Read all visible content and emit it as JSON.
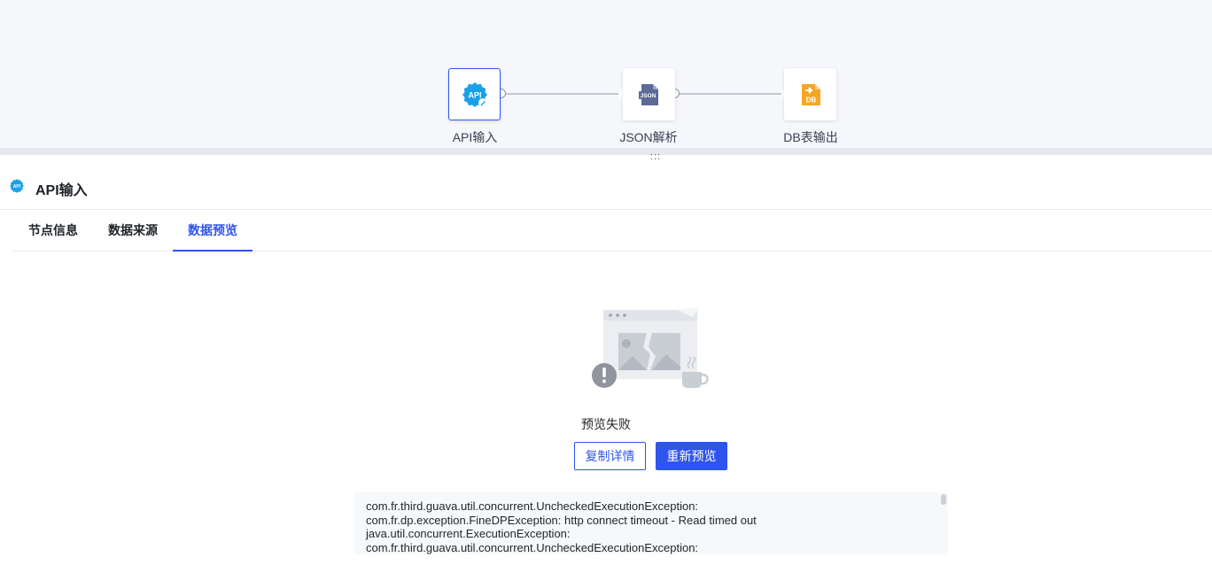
{
  "flow": {
    "nodes": [
      {
        "label": "API输入",
        "icon": "api-icon",
        "selected": true
      },
      {
        "label": "JSON解析",
        "icon": "json-file-icon",
        "selected": false
      },
      {
        "label": "DB表输出",
        "icon": "db-output-icon",
        "selected": false
      }
    ],
    "handle": ":::"
  },
  "panel": {
    "title": "API输入",
    "icon": "api-icon"
  },
  "tabs": [
    {
      "label": "节点信息",
      "active": false
    },
    {
      "label": "数据来源",
      "active": false
    },
    {
      "label": "数据预览",
      "active": true
    }
  ],
  "preview": {
    "status_text": "预览失败",
    "copy_button": "复制详情",
    "retry_button": "重新预览",
    "error_lines": [
      "com.fr.third.guava.util.concurrent.UncheckedExecutionException:",
      "com.fr.dp.exception.FineDPException: http connect timeout - Read timed out",
      "java.util.concurrent.ExecutionException:",
      "com.fr.third.guava.util.concurrent.UncheckedExecutionException:"
    ]
  },
  "colors": {
    "accent": "#2f54eb",
    "api_icon": "#1aa0e8",
    "db_icon": "#f5a623"
  }
}
